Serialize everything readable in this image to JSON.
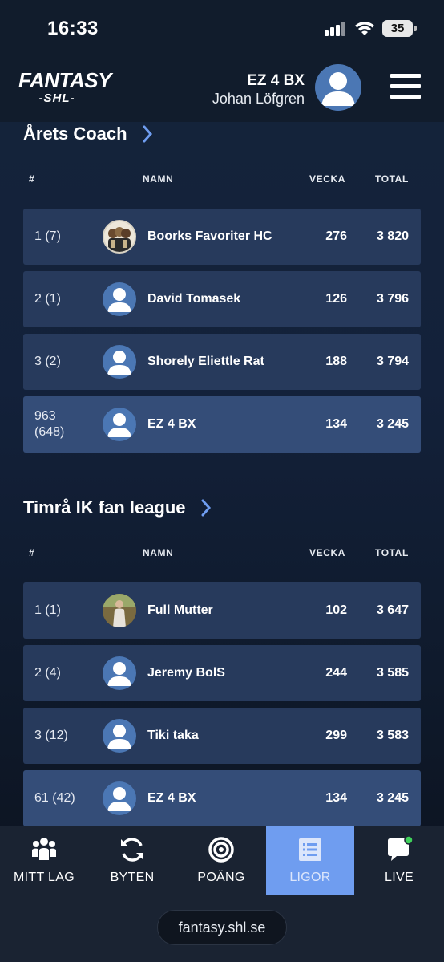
{
  "status_bar": {
    "time": "16:33",
    "battery": "35"
  },
  "header": {
    "logo_top": "FANTASY",
    "logo_bottom": "-SHL-",
    "team_name": "EZ 4 BX",
    "user_name": "Johan Löfgren"
  },
  "leagues": [
    {
      "title": "Årets Coach",
      "columns": {
        "rank": "#",
        "name": "NAMN",
        "week": "VECKA",
        "total": "TOTAL"
      },
      "rows": [
        {
          "rank": "1 (7)",
          "name": "Boorks Favoriter HC",
          "week": "276",
          "total": "3 820",
          "avatar": "team-photo"
        },
        {
          "rank": "2 (1)",
          "name": "David Tomasek",
          "week": "126",
          "total": "3 796",
          "avatar": "default-user"
        },
        {
          "rank": "3 (2)",
          "name": "Shorely Eliettle Rat",
          "week": "188",
          "total": "3 794",
          "avatar": "default-user"
        },
        {
          "rank": "963 (648)",
          "name": "EZ 4 BX",
          "week": "134",
          "total": "3 245",
          "avatar": "default-user",
          "is_me": true
        }
      ]
    },
    {
      "title": "Timrå IK fan league",
      "columns": {
        "rank": "#",
        "name": "NAMN",
        "week": "VECKA",
        "total": "TOTAL"
      },
      "rows": [
        {
          "rank": "1 (1)",
          "name": "Full Mutter",
          "week": "102",
          "total": "3 647",
          "avatar": "person-photo"
        },
        {
          "rank": "2 (4)",
          "name": "Jeremy BolS",
          "week": "244",
          "total": "3 585",
          "avatar": "default-user"
        },
        {
          "rank": "3 (12)",
          "name": "Tiki taka",
          "week": "299",
          "total": "3 583",
          "avatar": "default-user"
        },
        {
          "rank": "61 (42)",
          "name": "EZ 4 BX",
          "week": "134",
          "total": "3 245",
          "avatar": "default-user",
          "is_me": true
        }
      ]
    }
  ],
  "nav": {
    "tabs": [
      {
        "label": "MITT LAG",
        "icon": "team-icon"
      },
      {
        "label": "BYTEN",
        "icon": "swap-icon"
      },
      {
        "label": "POÄNG",
        "icon": "target-icon"
      },
      {
        "label": "LIGOR",
        "icon": "list-icon",
        "active": true
      },
      {
        "label": "LIVE",
        "icon": "chat-icon",
        "notification": true
      }
    ]
  },
  "browser": {
    "url": "fantasy.shl.se"
  },
  "colors": {
    "background": "#13213a",
    "row": "#273a5c",
    "row_me": "#344d78",
    "accent": "#6f9df0",
    "live_dot": "#3fd15a"
  }
}
